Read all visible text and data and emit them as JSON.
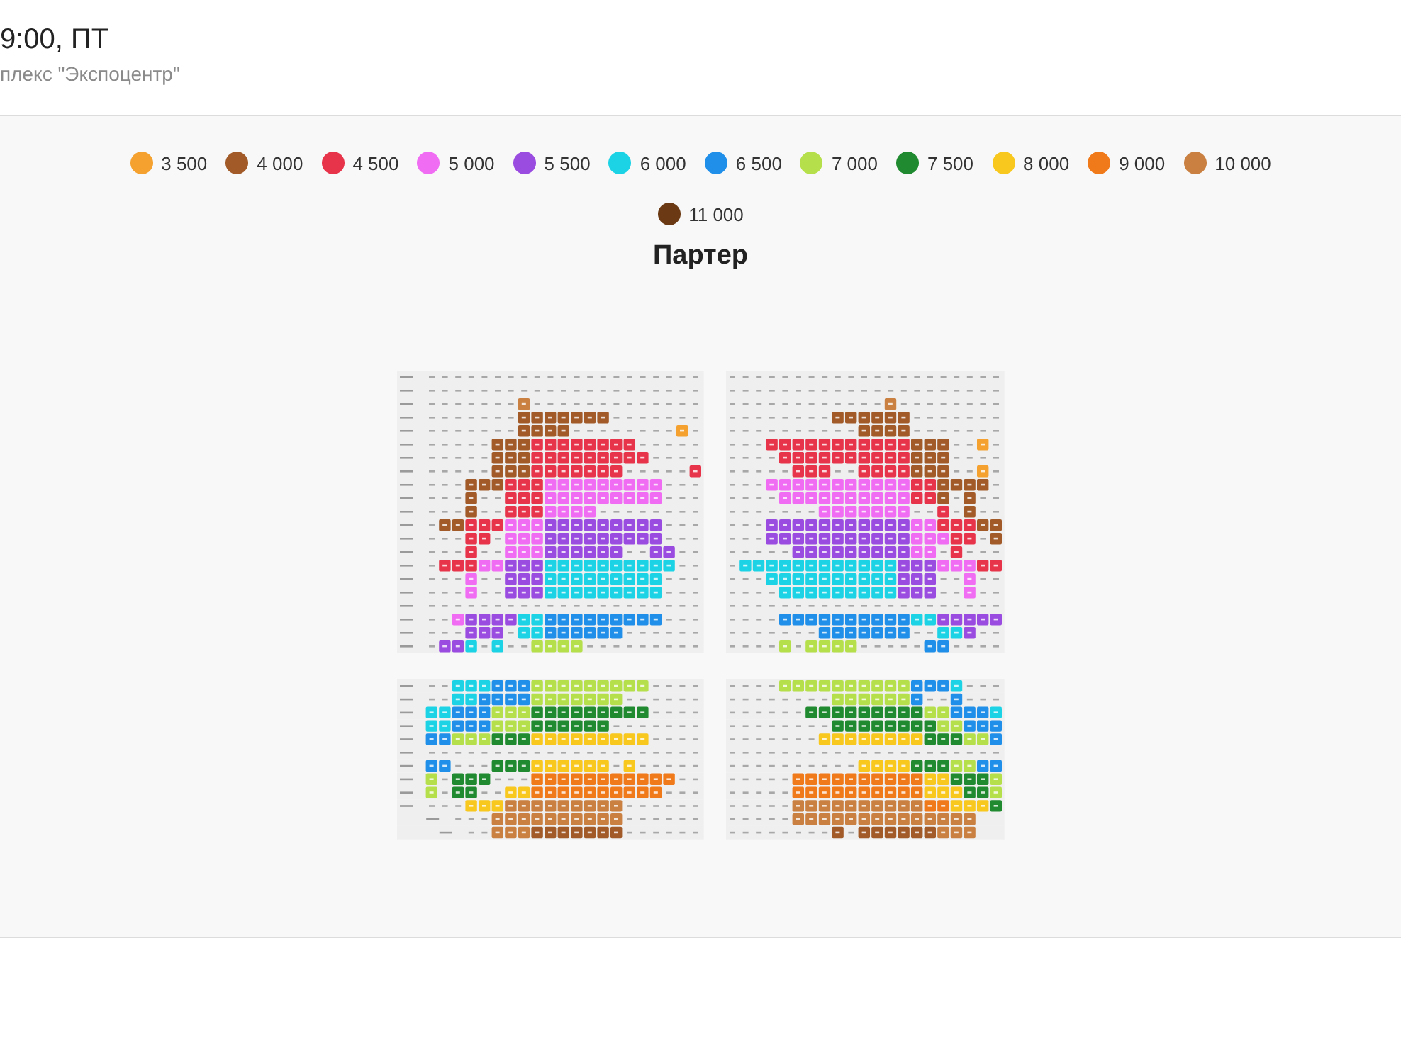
{
  "event": {
    "title": "9:00, ПТ",
    "venue": "плекс \"Экспоцентр\""
  },
  "legend": [
    {
      "label": "3 500",
      "color": "#f4a12f"
    },
    {
      "label": "4 000",
      "color": "#a15a28"
    },
    {
      "label": "4 500",
      "color": "#e8344b"
    },
    {
      "label": "5 000",
      "color": "#f06cf2"
    },
    {
      "label": "5 500",
      "color": "#9a4be0"
    },
    {
      "label": "6 000",
      "color": "#1cd3e6"
    },
    {
      "label": "6 500",
      "color": "#1f8fe9"
    },
    {
      "label": "7 000",
      "color": "#b6e04b"
    },
    {
      "label": "7 500",
      "color": "#1f8a2f"
    },
    {
      "label": "8 000",
      "color": "#f8c81f"
    },
    {
      "label": "9 000",
      "color": "#f0791a"
    },
    {
      "label": "10 000",
      "color": "#c98041"
    },
    {
      "label": "11 000",
      "color": "#6b3a14"
    }
  ],
  "hall": {
    "title": "Партер"
  }
}
